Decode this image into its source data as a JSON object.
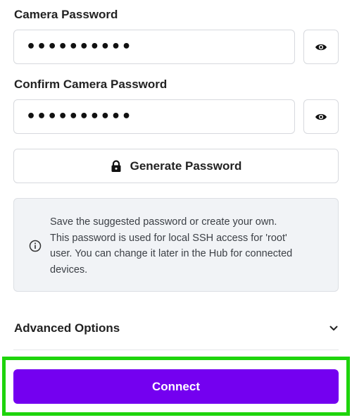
{
  "camera_password": {
    "label": "Camera Password",
    "value": "••••••••••",
    "toggle_icon": "eye-icon"
  },
  "confirm_password": {
    "label": "Confirm Camera Password",
    "value": "••••••••••",
    "toggle_icon": "eye-icon"
  },
  "generate_button": {
    "label": "Generate Password",
    "icon": "lock-icon"
  },
  "info": {
    "icon": "info-icon",
    "lines": [
      "Save the suggested password or create your own.",
      "This password is used for local SSH access for 'root'",
      "user. You can change it later in the Hub for connected",
      "devices."
    ]
  },
  "advanced": {
    "label": "Advanced Options",
    "icon": "chevron-down-icon"
  },
  "connect": {
    "label": "Connect"
  },
  "colors": {
    "accent": "#7400f0",
    "highlight": "#1ed40c"
  }
}
